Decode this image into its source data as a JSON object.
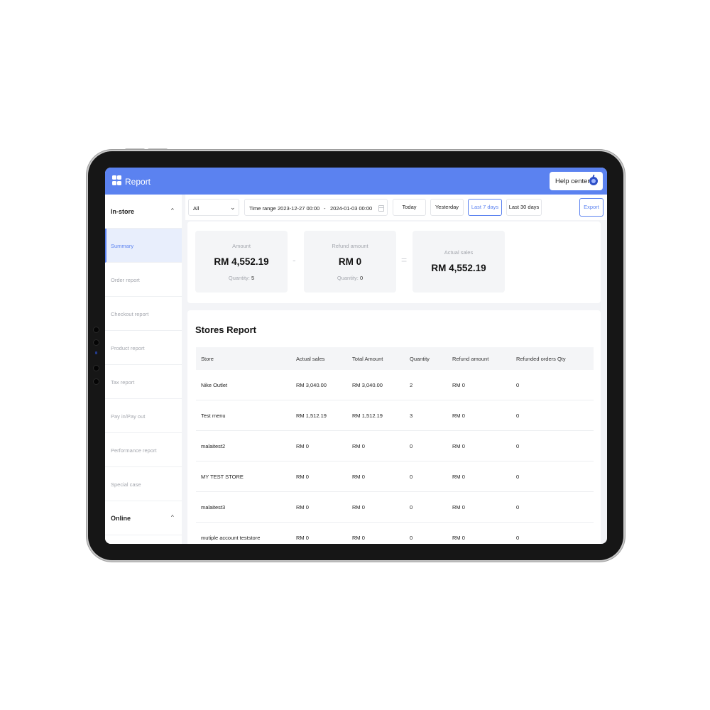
{
  "header": {
    "title": "Report",
    "help_label": "Help center"
  },
  "sidebar": {
    "groups": [
      {
        "label": "In-store",
        "expanded": true
      },
      {
        "label": "Online",
        "expanded": true
      }
    ],
    "items": [
      {
        "label": "Summary",
        "active": true
      },
      {
        "label": "Order report"
      },
      {
        "label": "Checkout report"
      },
      {
        "label": "Product report"
      },
      {
        "label": "Tax report"
      },
      {
        "label": "Pay in/Pay out"
      },
      {
        "label": "Performance report"
      },
      {
        "label": "Special case"
      }
    ]
  },
  "filters": {
    "store_select": "All",
    "time_range_label": "Time range",
    "start": "2023-12-27 00:00",
    "separator": "-",
    "end": "2024-01-03 00:00",
    "quick": [
      "Today",
      "Yesterday",
      "Last 7 days",
      "Last 30 days"
    ],
    "active_quick": "Last 7 days",
    "export_label": "Export"
  },
  "summary": {
    "amount": {
      "label": "Amount",
      "value": "RM 4,552.19",
      "qty_label": "Quantity:",
      "qty": "5"
    },
    "refund": {
      "label": "Refund amount",
      "value": "RM 0",
      "qty_label": "Quantity:",
      "qty": "0"
    },
    "actual": {
      "label": "Actual sales",
      "value": "RM 4,552.19"
    },
    "minus_sign": "-",
    "equals_sign": "="
  },
  "stores_report": {
    "title": "Stores Report",
    "columns": [
      "Store",
      "Actual sales",
      "Total Amount",
      "Quantity",
      "Refund amount",
      "Refunded orders Qty"
    ],
    "rows": [
      [
        "Nike Outlet",
        "RM 3,040.00",
        "RM 3,040.00",
        "2",
        "RM 0",
        "0"
      ],
      [
        "Test menu",
        "RM 1,512.19",
        "RM 1,512.19",
        "3",
        "RM 0",
        "0"
      ],
      [
        "malaitest2",
        "RM 0",
        "RM 0",
        "0",
        "RM 0",
        "0"
      ],
      [
        "MY TEST STORE",
        "RM 0",
        "RM 0",
        "0",
        "RM 0",
        "0"
      ],
      [
        "malaitest3",
        "RM 0",
        "RM 0",
        "0",
        "RM 0",
        "0"
      ],
      [
        "mutiple account teststore",
        "RM 0",
        "RM 0",
        "0",
        "RM 0",
        "0"
      ]
    ]
  },
  "colors": {
    "accent": "#5b82f0",
    "background": "#f3f4f7",
    "frame": "#161616"
  },
  "icons": [
    "apps-grid-icon",
    "help-center-icon",
    "chevron-up-icon",
    "chevron-down-icon",
    "calendar-icon"
  ]
}
